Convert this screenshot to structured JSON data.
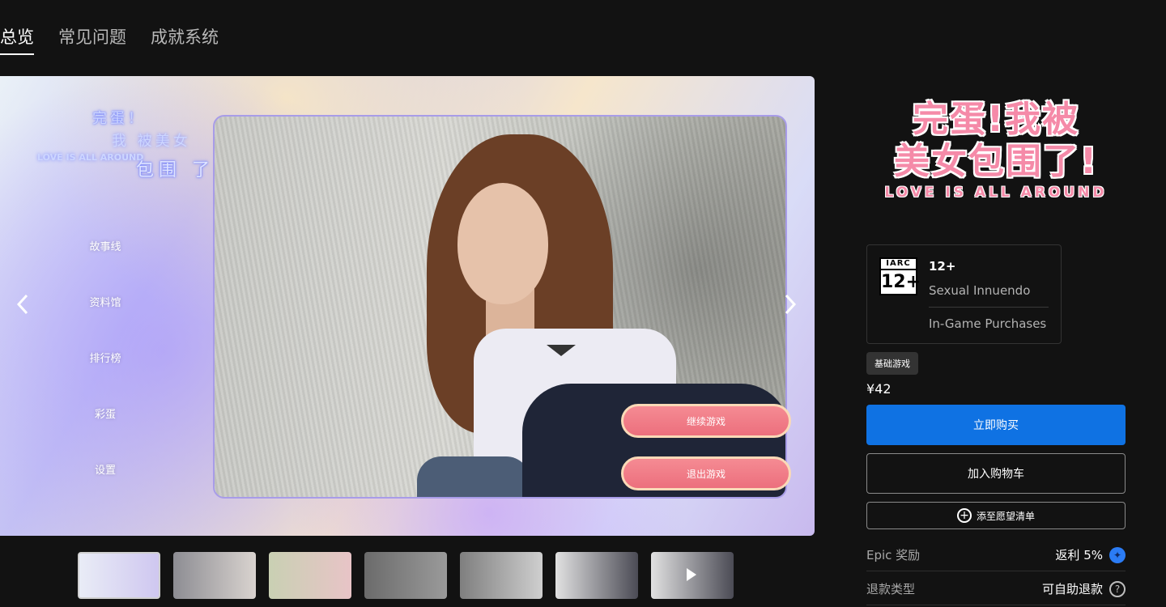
{
  "tabs": [
    {
      "label": "总览",
      "active": true
    },
    {
      "label": "常见问题",
      "active": false
    },
    {
      "label": "成就系统",
      "active": false
    }
  ],
  "hero": {
    "logo_lines": [
      "完蛋！",
      "我 被美女",
      "LOVE IS ALL AROUND",
      "包围 了!"
    ],
    "menu_items": [
      "故事线",
      "资料馆",
      "排行榜",
      "彩蛋",
      "设置"
    ],
    "continue_label": "继续游戏",
    "exit_label": "退出游戏"
  },
  "thumbnails": [
    {
      "active": true,
      "colors": [
        "#e9ecf6",
        "#cfc7f0"
      ]
    },
    {
      "active": false,
      "colors": [
        "#8d8d93",
        "#d9d3cf"
      ]
    },
    {
      "active": false,
      "colors": [
        "#c9d0b3",
        "#e8c4c7"
      ]
    },
    {
      "active": false,
      "colors": [
        "#6b6b6b",
        "#9a9a9a"
      ]
    },
    {
      "active": false,
      "colors": [
        "#7f7f7f",
        "#cfcfcf"
      ]
    },
    {
      "active": false,
      "colors": [
        "#e1e1e1",
        "#4b4b55"
      ]
    },
    {
      "active": false,
      "colors": [
        "#e1e1e1",
        "#4b4b55"
      ],
      "video": true
    }
  ],
  "game": {
    "logo_line1": "完蛋!我被",
    "logo_line2": "美女包围了!",
    "logo_subtitle": "LOVE IS ALL AROUND",
    "iarc_label": "IARC",
    "iarc_age": "12+",
    "age": "12+",
    "descriptors": [
      "Sexual Innuendo",
      "In-Game Purchases"
    ],
    "badge": "基础游戏",
    "price": "¥42",
    "buy_label": "立即购买",
    "cart_label": "加入购物车",
    "wishlist_label": "添至愿望清单"
  },
  "info": [
    {
      "key": "Epic 奖励",
      "value": "返利 5%",
      "icon": "epic-reward-icon"
    },
    {
      "key": "退款类型",
      "value": "可自助退款",
      "icon": "help-icon"
    }
  ]
}
